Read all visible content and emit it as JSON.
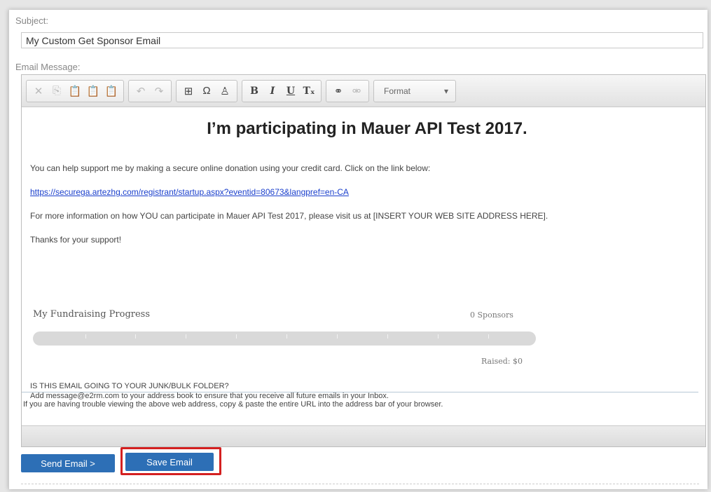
{
  "form": {
    "subject_label": "Subject:",
    "subject_value": "My Custom Get Sponsor Email",
    "message_label": "Email Message:"
  },
  "toolbar": {
    "groups": [
      [
        {
          "icon": "cut-icon",
          "glyph": "✕",
          "enabled": false
        },
        {
          "icon": "copy-icon",
          "glyph": "⎘",
          "enabled": false
        },
        {
          "icon": "paste-icon",
          "glyph": "📋",
          "enabled": true
        },
        {
          "icon": "paste-text-icon",
          "glyph": "📋",
          "enabled": true
        },
        {
          "icon": "paste-word-icon",
          "glyph": "📋",
          "enabled": true
        }
      ],
      [
        {
          "icon": "undo-icon",
          "glyph": "↶",
          "enabled": false
        },
        {
          "icon": "redo-icon",
          "glyph": "↷",
          "enabled": false
        }
      ],
      [
        {
          "icon": "table-icon",
          "glyph": "⊞",
          "enabled": true
        },
        {
          "icon": "special-char-icon",
          "glyph": "Ω",
          "enabled": true
        },
        {
          "icon": "user-icon",
          "glyph": "♙",
          "enabled": true
        }
      ],
      [
        {
          "icon": "bold-icon",
          "glyph": "B",
          "enabled": true
        },
        {
          "icon": "italic-icon",
          "glyph": "I",
          "enabled": true
        },
        {
          "icon": "underline-icon",
          "glyph": "U",
          "enabled": true
        },
        {
          "icon": "remove-format-icon",
          "glyph": "Tₓ",
          "enabled": true
        }
      ],
      [
        {
          "icon": "link-icon",
          "glyph": "⚭",
          "enabled": true
        },
        {
          "icon": "unlink-icon",
          "glyph": "⚮",
          "enabled": false
        }
      ]
    ],
    "format_label": "Format",
    "format_arrow": "▾"
  },
  "body": {
    "headline": "I’m participating in Mauer API Test 2017.",
    "intro": "You can help support me by making a secure online donation using your credit card. Click on the link below:",
    "donation_link": "https://securega.artezhg.com/registrant/startup.aspx?eventid=80673&langpref=en-CA",
    "more_info": "For more information on how YOU can participate in Mauer API Test 2017, please visit us at [INSERT YOUR WEB SITE ADDRESS HERE].",
    "thanks": "Thanks for your support!",
    "progress_title": "My Fundraising Progress",
    "sponsors": "0 Sponsors",
    "raised": "Raised: $0",
    "progress_fraction": 0,
    "trouble": "If you are having trouble viewing the above web address, copy & paste the entire URL into the address bar of your browser.",
    "junk_heading": "IS THIS EMAIL GOING TO YOUR JUNK/BULK FOLDER?",
    "junk_text": "Add message@e2rm.com to your address book to ensure that you receive all future emails in your Inbox."
  },
  "actions": {
    "send_label": "Send Email >",
    "save_label": "Save Email"
  },
  "colors": {
    "button_blue": "#2d6fb6",
    "link_blue": "#1a3fcc",
    "highlight_red": "#d42020"
  }
}
